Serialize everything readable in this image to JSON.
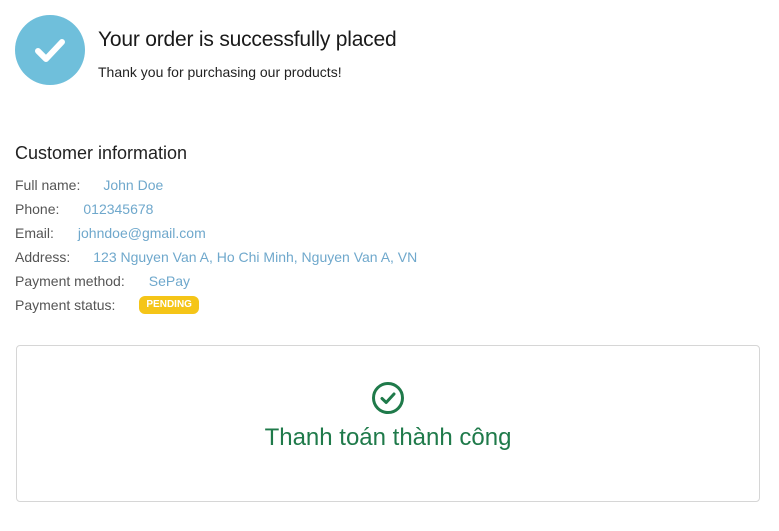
{
  "header": {
    "icon": "check-icon",
    "title": "Your order is successfully placed",
    "subtitle": "Thank you for purchasing our products!"
  },
  "customer": {
    "heading": "Customer information",
    "fields": [
      {
        "label": "Full name:",
        "value": "John Doe"
      },
      {
        "label": "Phone:",
        "value": "012345678"
      },
      {
        "label": "Email:",
        "value": "johndoe@gmail.com"
      },
      {
        "label": "Address:",
        "value": "123 Nguyen Van A, Ho Chi Minh, Nguyen Van A, VN"
      },
      {
        "label": "Payment method:",
        "value": "SePay"
      },
      {
        "label": "Payment status:",
        "value": "PENDING"
      }
    ]
  },
  "payment_result": {
    "icon": "check-circle-icon",
    "message": "Thanh toán thành công"
  },
  "colors": {
    "accent": "#6fbfdb",
    "value_text": "#6fa8cc",
    "pending_badge": "#f5c518",
    "success": "#1f7a4a"
  }
}
